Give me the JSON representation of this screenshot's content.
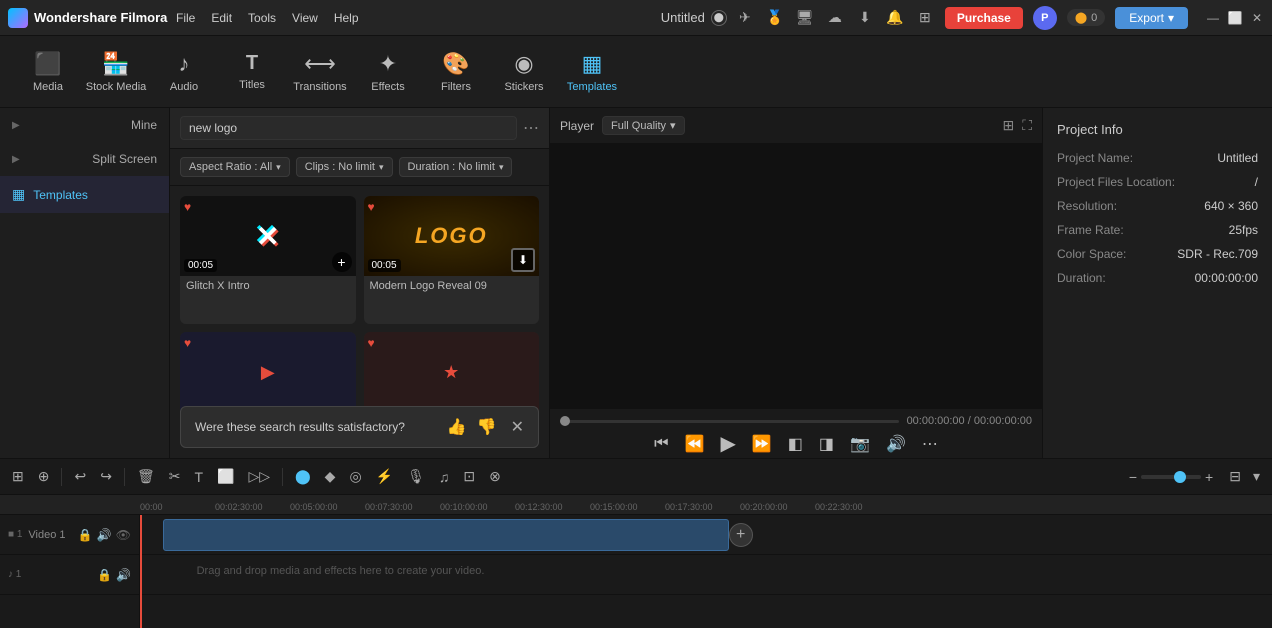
{
  "app": {
    "name": "Wondershare Filmora",
    "title": "Untitled"
  },
  "topbar": {
    "menu": [
      "File",
      "Edit",
      "Tools",
      "View",
      "Help"
    ],
    "purchase_label": "Purchase",
    "export_label": "Export",
    "avatar_initials": "P",
    "points": "0",
    "minimize": "—",
    "maximize": "⬜",
    "close": "✕"
  },
  "toolbar": {
    "items": [
      {
        "id": "media",
        "label": "Media",
        "icon": "🎬"
      },
      {
        "id": "stock",
        "label": "Stock Media",
        "icon": "🏪"
      },
      {
        "id": "audio",
        "label": "Audio",
        "icon": "🎵"
      },
      {
        "id": "titles",
        "label": "Titles",
        "icon": "T"
      },
      {
        "id": "transitions",
        "label": "Transitions",
        "icon": "⟷"
      },
      {
        "id": "effects",
        "label": "Effects",
        "icon": "✨"
      },
      {
        "id": "filters",
        "label": "Filters",
        "icon": "🎨"
      },
      {
        "id": "stickers",
        "label": "Stickers",
        "icon": "😊"
      },
      {
        "id": "templates",
        "label": "Templates",
        "icon": "▦"
      }
    ],
    "active": "templates"
  },
  "left_panel": {
    "mine_label": "Mine",
    "split_screen_label": "Split Screen",
    "templates_label": "Templates"
  },
  "search": {
    "placeholder": "new logo",
    "value": "new logo"
  },
  "filters": {
    "aspect_ratio_label": "Aspect Ratio : All",
    "clips_label": "Clips : No limit",
    "duration_label": "Duration : No limit"
  },
  "templates": [
    {
      "id": 1,
      "name": "Glitch X Intro",
      "duration": "00:05",
      "has_heart": true,
      "thumb_type": "glitch"
    },
    {
      "id": 2,
      "name": "Modern Logo Reveal 09",
      "duration": "00:05",
      "has_heart": true,
      "thumb_type": "logo"
    },
    {
      "id": 3,
      "name": "",
      "duration": "",
      "has_heart": true,
      "thumb_type": "partial"
    },
    {
      "id": 4,
      "name": "",
      "duration": "",
      "has_heart": true,
      "thumb_type": "partial2"
    }
  ],
  "search_toast": {
    "text": "Were these search results satisfactory?"
  },
  "player": {
    "label": "Player",
    "quality": "Full Quality",
    "time_current": "00:00:00:00",
    "time_total": "00:00:00:00"
  },
  "project_info": {
    "title": "Project Info",
    "name_label": "Project Name:",
    "name_value": "Untitled",
    "files_label": "Project Files Location:",
    "files_value": "/",
    "resolution_label": "Resolution:",
    "resolution_value": "640 × 360",
    "frame_rate_label": "Frame Rate:",
    "frame_rate_value": "25fps",
    "color_space_label": "Color Space:",
    "color_space_value": "SDR - Rec.709",
    "duration_label": "Duration:",
    "duration_value": "00:00:00:00"
  },
  "timeline": {
    "ruler_marks": [
      "00:02:30:00",
      "00:05:00:00",
      "00:07:30:00",
      "00:10:00:00",
      "00:12:30:00",
      "00:15:00:00",
      "00:17:30:00",
      "00:20:00:00",
      "00:22:30:00"
    ],
    "tracks": [
      {
        "id": "video1",
        "label": "Video 1",
        "num": 1
      },
      {
        "id": "audio1",
        "label": "",
        "num": 1
      }
    ],
    "dnd_text": "Drag and drop media and effects here to create your video."
  }
}
